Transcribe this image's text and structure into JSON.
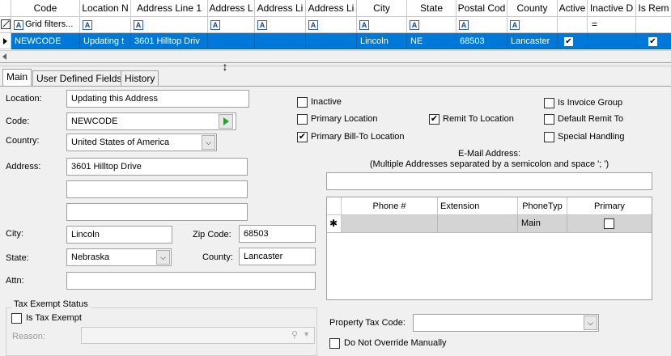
{
  "grid": {
    "headers": [
      "Code",
      "Location N",
      "Address Line 1",
      "Address L",
      "Address Li",
      "Address Li",
      "City",
      "State",
      "Postal Cod",
      "County",
      "Active",
      "Inactive D",
      "Is Rem"
    ],
    "filter_text": "Grid filters...",
    "filter_equals": "=",
    "row": {
      "code": "NEWCODE",
      "location": "Updating t",
      "address1": "3601 Hilltop Driv",
      "city": "Lincoln",
      "state": "NE",
      "postal": "68503",
      "county": "Lancaster",
      "active_check": "✔",
      "is_remit_check": "✔"
    }
  },
  "tabs": [
    "Main",
    "User Defined Fields",
    "History"
  ],
  "form": {
    "location_label": "Location:",
    "location_value": "Updating this Address",
    "code_label": "Code:",
    "code_value": "NEWCODE",
    "country_label": "Country:",
    "country_value": "United States of America",
    "address_label": "Address:",
    "address1_value": "3601 Hilltop Drive",
    "address2_value": "",
    "address3_value": "",
    "city_label": "City:",
    "city_value": "Lincoln",
    "zip_label": "Zip Code:",
    "zip_value": "68503",
    "state_label": "State:",
    "state_value": "Nebraska",
    "county_label": "County:",
    "county_value": "Lancaster",
    "attn_label": "Attn:",
    "attn_value": ""
  },
  "checks": {
    "inactive": "Inactive",
    "primary_location": "Primary Location",
    "primary_billto": "Primary Bill-To Location",
    "remit_to": "Remit To Location",
    "invoice_group": "Is Invoice Group",
    "default_remit": "Default Remit To",
    "special_handling": "Special Handling",
    "checkmark": "✔"
  },
  "email": {
    "title": "E-Mail Address:",
    "note": "(Multiple Addresses separated by a semicolon and space '; ')",
    "value": ""
  },
  "phone_grid": {
    "headers": [
      "Phone #",
      "Extension",
      "PhoneTyp",
      "Primary"
    ],
    "new_row_marker": "✱",
    "phone_type": "Main"
  },
  "tax": {
    "group_title": "Tax Exempt Status",
    "is_tax_exempt": "Is Tax Exempt",
    "reason_label": "Reason:",
    "property_tax_label": "Property Tax Code:",
    "do_not_override": "Do Not Override Manually"
  }
}
